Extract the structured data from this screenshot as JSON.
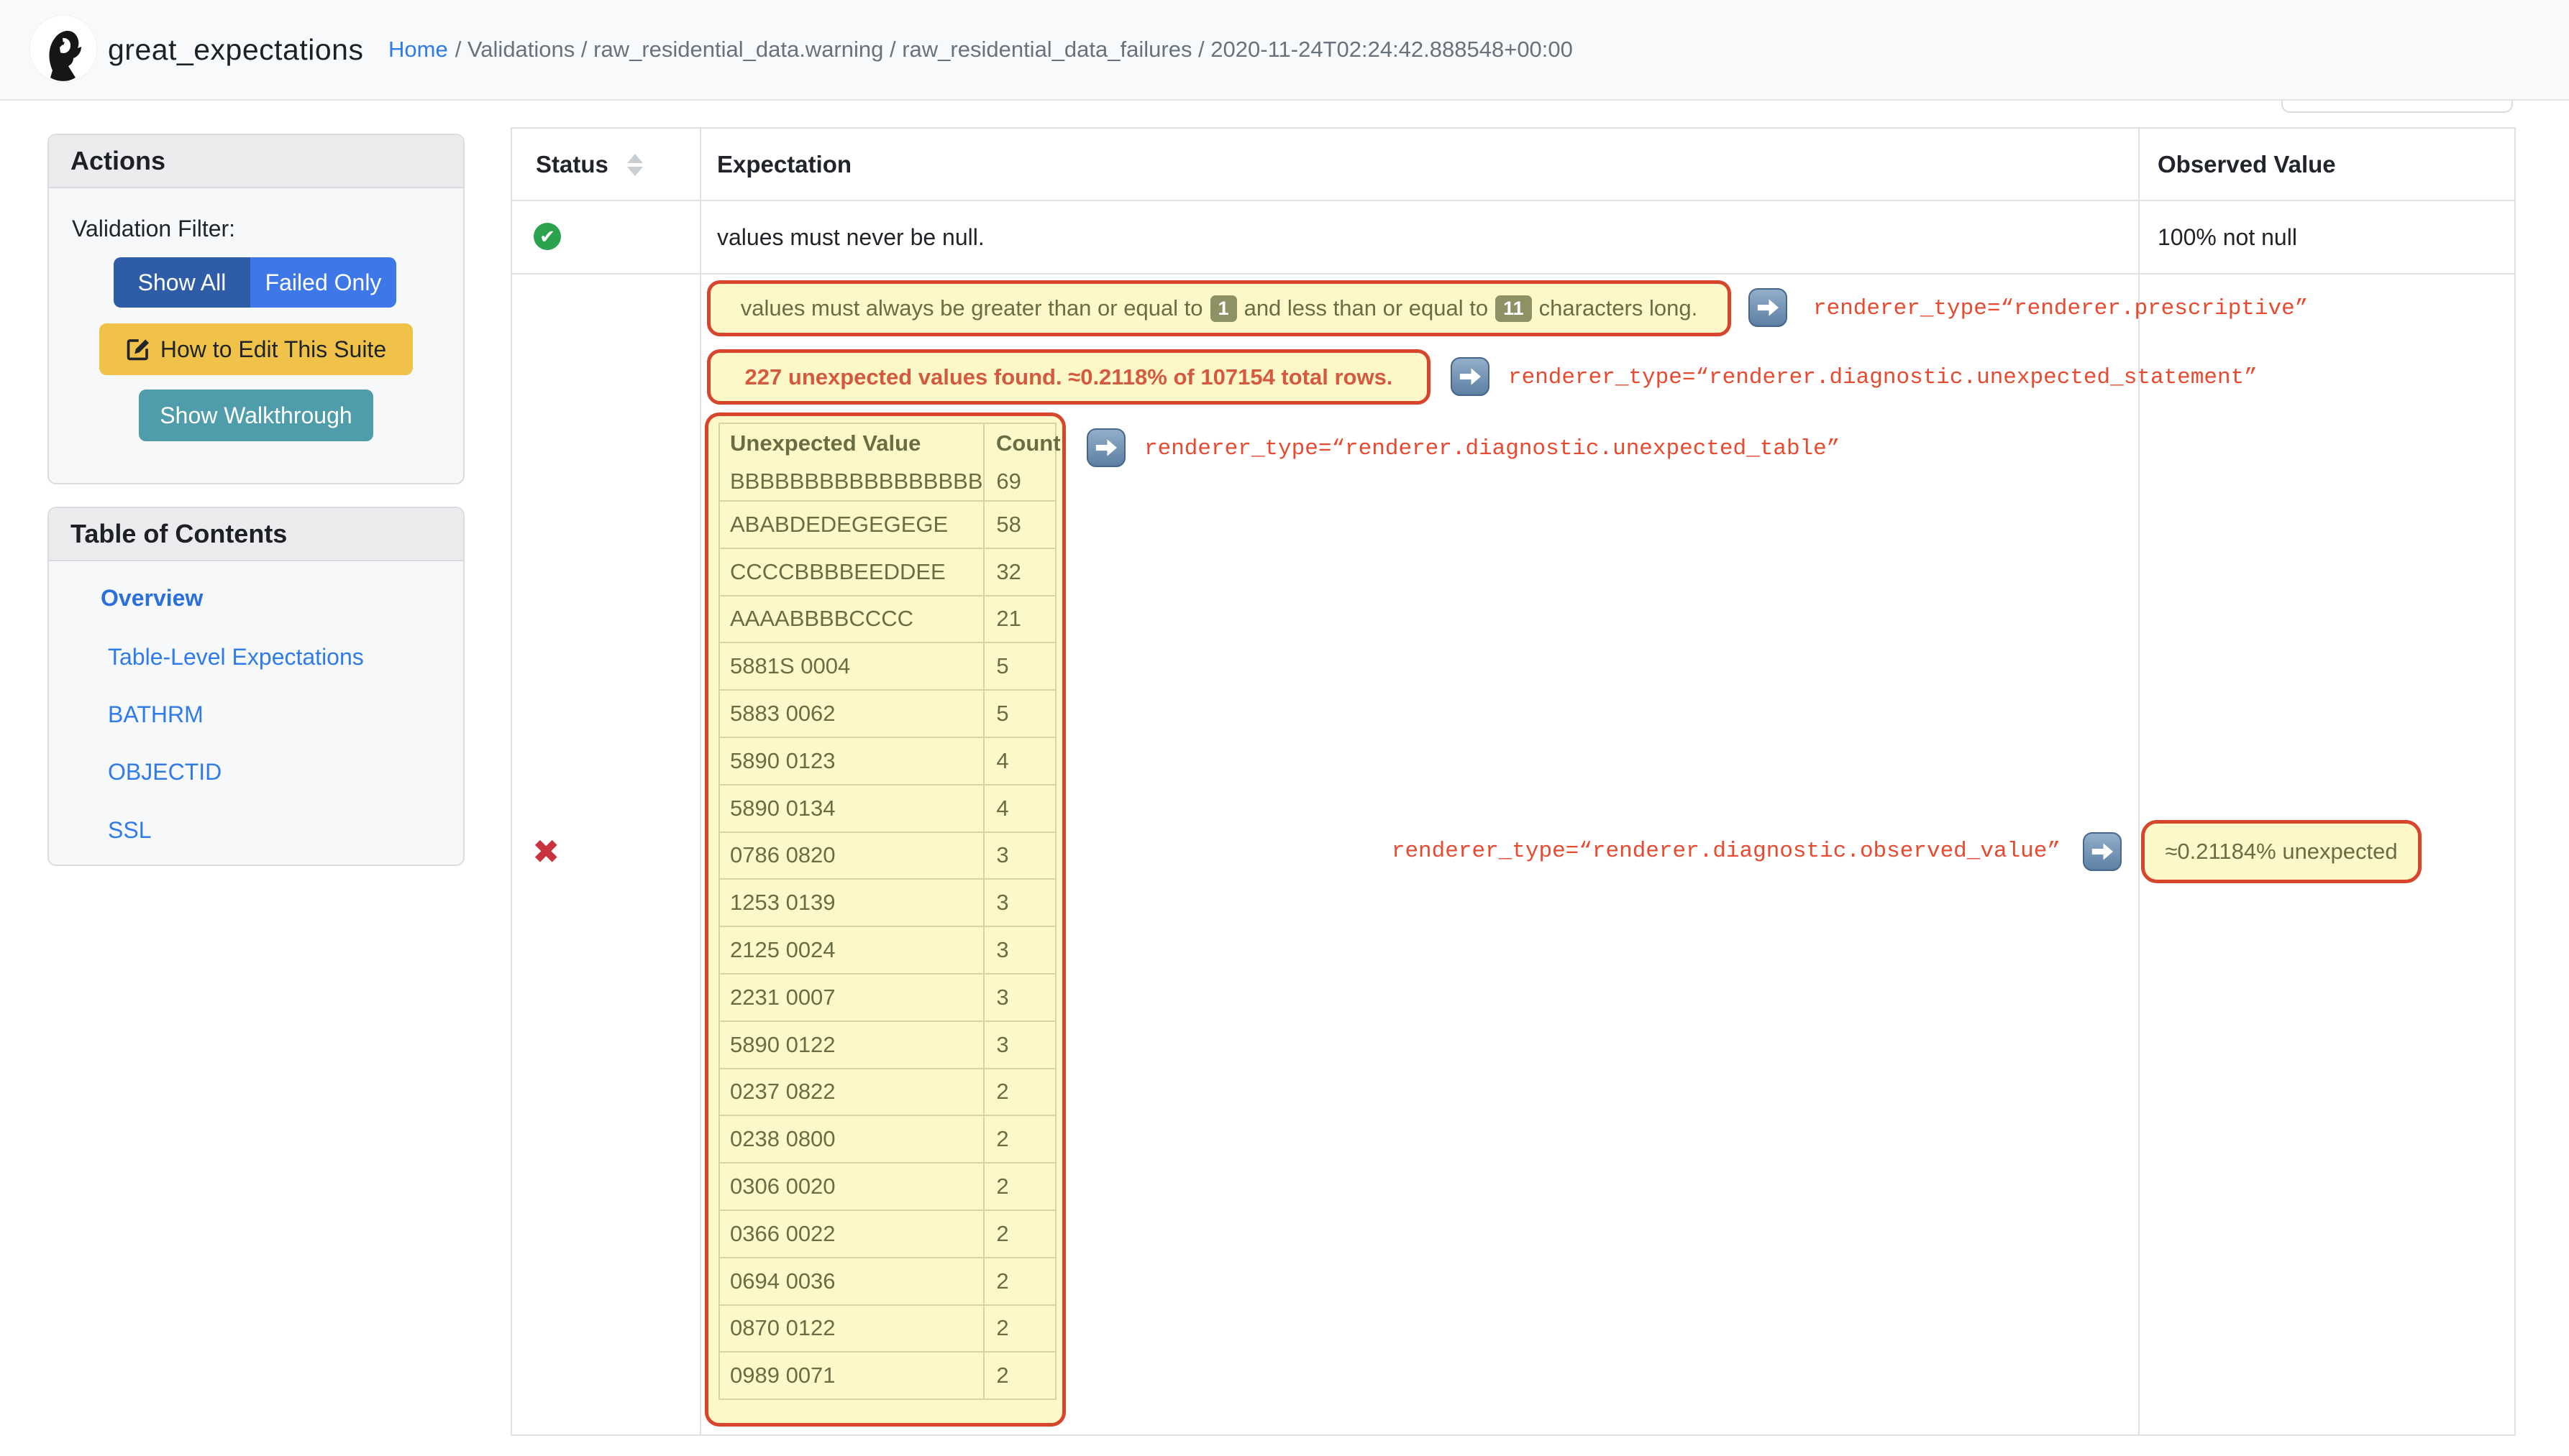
{
  "header": {
    "title": "great_expectations",
    "breadcrumb": {
      "home": "Home",
      "rest": "/ Validations / raw_residential_data.warning / raw_residential_data_failures / 2020-11-24T02:24:42.888548+00:00"
    }
  },
  "sidebar": {
    "actions": {
      "title": "Actions",
      "filter_label": "Validation Filter:",
      "show_all": "Show All",
      "failed_only": "Failed Only",
      "edit_suite": "How to Edit This Suite",
      "walkthrough": "Show Walkthrough"
    },
    "toc": {
      "title": "Table of Contents",
      "items": [
        {
          "label": "Overview"
        },
        {
          "label": "Table-Level Expectations"
        },
        {
          "label": "BATHRM"
        },
        {
          "label": "OBJECTID"
        },
        {
          "label": "SSL"
        }
      ]
    }
  },
  "table": {
    "columns": [
      "Status",
      "Expectation",
      "Observed Value"
    ],
    "passed_row": {
      "status": "success",
      "expectation": "values must never be null.",
      "observed": "100% not null"
    },
    "failed_row": {
      "status": "failed"
    }
  },
  "annotations": {
    "prescriptive": {
      "text_before": "values must always be greater than or equal to",
      "badge_min": "1",
      "text_middle": "and less than or equal to",
      "badge_max": "11",
      "text_after": "characters long.",
      "renderer_label": "renderer_type=“renderer.prescriptive”"
    },
    "unexpected_statement": {
      "text": "227 unexpected values found. ≈0.2118% of 107154 total rows.",
      "renderer_label": "renderer_type=“renderer.diagnostic.unexpected_statement”"
    },
    "unexpected_table": {
      "columns": [
        "Unexpected Value",
        "Count"
      ],
      "rows": [
        [
          "BBBBBBBBBBBBBBBBB",
          "69"
        ],
        [
          "ABABDEDEGEGEGE",
          "58"
        ],
        [
          "CCCCBBBBEEDDEE",
          "32"
        ],
        [
          "AAAABBBBCCCC",
          "21"
        ],
        [
          "5881S 0004",
          "5"
        ],
        [
          "5883 0062",
          "5"
        ],
        [
          "5890 0123",
          "4"
        ],
        [
          "5890 0134",
          "4"
        ],
        [
          "0786 0820",
          "3"
        ],
        [
          "1253 0139",
          "3"
        ],
        [
          "2125 0024",
          "3"
        ],
        [
          "2231 0007",
          "3"
        ],
        [
          "5890 0122",
          "3"
        ],
        [
          "0237 0822",
          "2"
        ],
        [
          "0238 0800",
          "2"
        ],
        [
          "0306 0020",
          "2"
        ],
        [
          "0366 0022",
          "2"
        ],
        [
          "0694 0036",
          "2"
        ],
        [
          "0870 0122",
          "2"
        ],
        [
          "0989 0071",
          "2"
        ]
      ],
      "renderer_label": "renderer_type=“renderer.diagnostic.unexpected_table”"
    },
    "observed_value": {
      "renderer_label": "renderer_type=“renderer.diagnostic.observed_value”",
      "callout": "≈0.21184% unexpected"
    }
  },
  "colors": {
    "annotation_border_red": "#d6452c",
    "annotation_bg_yellow": "#fcf8c8",
    "annotation_text_olive": "#6a6d44",
    "renderer_label_red": "#e8492f",
    "statement_text": "#d4593f",
    "link_blue": "#2f7bea",
    "show_all_blue": "#2e5ca6",
    "failed_only_blue": "#3d77e8",
    "edit_yellow": "#f0c24a",
    "walkthrough_teal": "#4f9dab",
    "success_green": "#2ba24c",
    "fail_red": "#c9323f"
  }
}
